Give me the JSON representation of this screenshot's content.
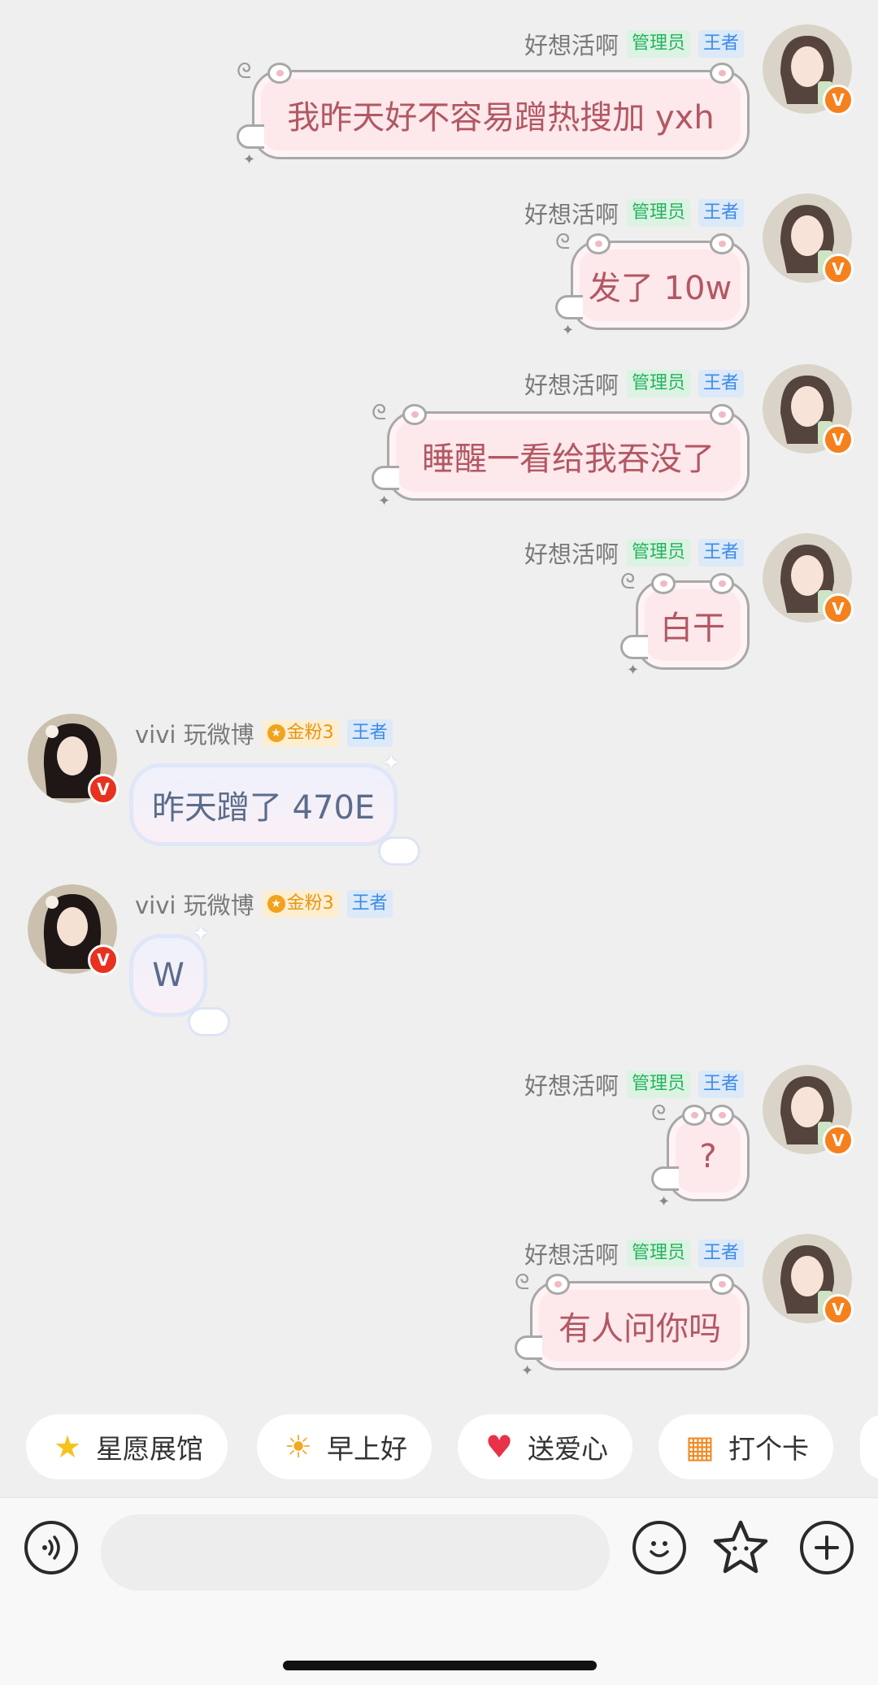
{
  "self_user": {
    "name": "好想活啊",
    "tags": [
      "管理员",
      "王者"
    ]
  },
  "other_user": {
    "name": "vivi 玩微博",
    "tags": [
      "金粉3",
      "王者"
    ]
  },
  "messages": [
    {
      "text": "我昨天好不容易蹭热搜加 yxh"
    },
    {
      "text": "发了 10w"
    },
    {
      "text": "睡醒一看给我吞没了"
    },
    {
      "text": "白干"
    },
    {
      "text": "昨天蹭了 470E"
    },
    {
      "text": "W"
    },
    {
      "text": "?"
    },
    {
      "text": "有人问你吗"
    }
  ],
  "verified_badge": "V",
  "chips": [
    {
      "label": "星愿展馆",
      "icon": "star-icon"
    },
    {
      "label": "早上好",
      "icon": "sun-icon"
    },
    {
      "label": "送爱心",
      "icon": "heart-icon"
    },
    {
      "label": "打个卡",
      "icon": "calendar-icon"
    }
  ],
  "input": {
    "placeholder": "",
    "value": ""
  },
  "colors": {
    "background": "#efefef",
    "self_bubble": "#fde8ec",
    "self_text": "#b25862",
    "other_bubble": "#eef1fb",
    "other_text": "#5b6c8c",
    "badge_orange": "#f5811e",
    "admin_tag": "#24b45c",
    "king_tag": "#3d8be6",
    "gold_tag": "#e79613"
  }
}
